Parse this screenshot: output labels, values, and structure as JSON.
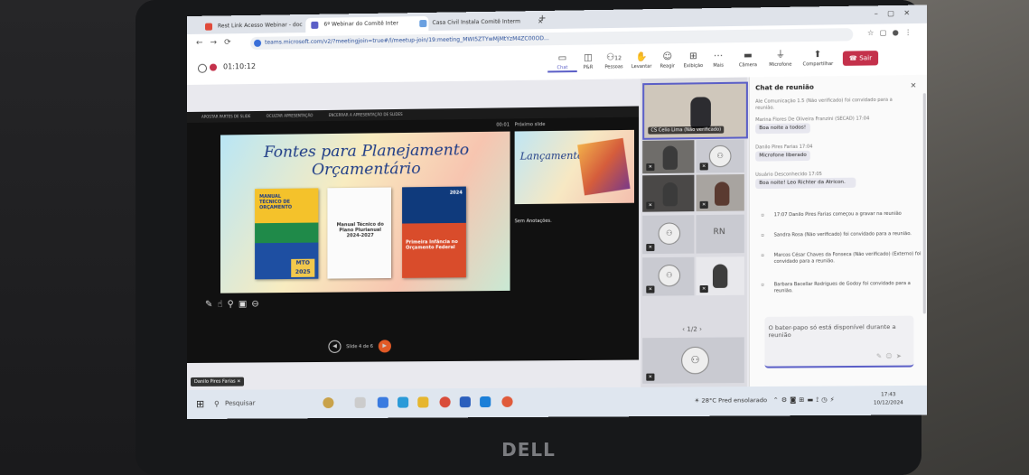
{
  "browser": {
    "tabs": [
      {
        "label": "Rest Link Acesso Webinar - doc"
      },
      {
        "label": "6º Webinar do Comitê Inter"
      },
      {
        "label": "Casa Civil Instala Comitê Interm"
      }
    ],
    "url": "teams.microsoft.com/v2/?meetingjoin=true#/l/meetup-join/19:meeting_MWI5ZTYwMjMtYzM4ZC00OD..."
  },
  "teams": {
    "timer": "01:10:12",
    "toolbar": [
      {
        "icon": "chat-icon",
        "label": "Chat"
      },
      {
        "icon": "hand-icon",
        "label": "P&R"
      },
      {
        "icon": "people-icon",
        "label": "Pessoas",
        "badge": "12"
      },
      {
        "icon": "raise-hand-icon",
        "label": "Levantar"
      },
      {
        "icon": "react-icon",
        "label": "Reagir"
      },
      {
        "icon": "view-icon",
        "label": "Exibição"
      },
      {
        "icon": "more-icon",
        "label": "Mais"
      },
      {
        "icon": "camera-icon",
        "label": "Câmera"
      },
      {
        "icon": "mic-icon",
        "label": "Microfone"
      },
      {
        "icon": "share-icon",
        "label": "Compartilhar"
      }
    ],
    "leave_label": "Sair"
  },
  "presentation": {
    "top_items": [
      "APOSTAR PARTES DE SLIDE",
      "OCULTAR APRESENTAÇÃO",
      "ENCERRAR A APRESENTAÇÃO DE SLIDES"
    ],
    "clock": "00:01",
    "slide_title": "Fontes para Planejamento Orçamentário",
    "book1": "MANUAL TÉCNICO DE ORÇAMENTO",
    "book1_badge": "MTO 2025",
    "book2": "Manual Técnico do Plano Plurianual 2024-2027",
    "book3": "Primeira Infância no Orçamento Federal",
    "book3_year": "2024",
    "next_label": "Próximo slide",
    "next_title": "Lançamento do livro",
    "notes": "Sem Anotações.",
    "slide_counter": "Slide 4 de 6"
  },
  "gallery": {
    "featured": "CS Celio Lima (Não verificado)",
    "initials": "RN",
    "pager": "1/2",
    "presenter": "Danilo Pires Farias"
  },
  "chat": {
    "title": "Chat de reunião",
    "messages": [
      {
        "meta": "Ale Comunicação 1.5 (Não verificado) foi convidado para a reunião.",
        "text": ""
      },
      {
        "meta": "Marina Flores De Oliveira Franzini (SECAD)  17:04",
        "text": "Boa noite a todos!"
      },
      {
        "meta": "Danilo Pires Farias  17:04",
        "text": "Microfone liberado"
      },
      {
        "meta": "Usuário Desconhecido  17:05",
        "text": "Boa noite! Leo Richter da Atricon."
      }
    ],
    "system": [
      "17:07  Danilo Pires Farias começou a gravar na reunião",
      "Sandra Rosa (Não verificado) foi convidado para a reunião.",
      "Marcos César Chaves da Fonseca (Não verificado) (Externo) foi convidado para a reunião.",
      "Barbara Bacellar Rodrigues de Godoy foi convidado para a reunião."
    ],
    "input_note": "O bater-papo só está disponível durante a reunião"
  },
  "taskbar": {
    "search": "Pesquisar",
    "weather": "28°C  Pred ensolarado",
    "time": "17:43",
    "date": "10/12/2024"
  },
  "brand": "DELL"
}
